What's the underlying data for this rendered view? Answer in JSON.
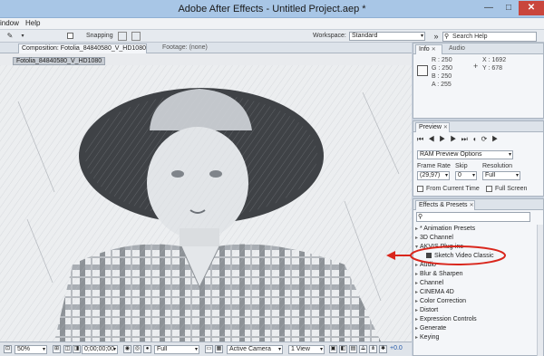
{
  "window": {
    "title": "Adobe After Effects - Untitled Project.aep *"
  },
  "menu": [
    "indow",
    "Help"
  ],
  "toolbar": {
    "snapping_label": "Snapping",
    "workspace_label": "Workspace:",
    "workspace_value": "Standard",
    "search_placeholder": "Search Help"
  },
  "composition_panel": {
    "tab_label": "Composition: Fotolia_84840580_V_HD1080",
    "footage_tab_label": "Footage: (none)",
    "layer_tag": "Fotolia_84840580_V_HD1080"
  },
  "viewer_status": {
    "magnification": "50%",
    "timecode": "0;00;00;00",
    "resolution": "Full",
    "camera": "Active Camera",
    "view": "1 View",
    "exposure": "+0.0"
  },
  "info_panel": {
    "tab_info": "Info",
    "tab_audio": "Audio",
    "r_label": "R :",
    "r_value": "250",
    "g_label": "G :",
    "g_value": "250",
    "b_label": "B :",
    "b_value": "250",
    "a_label": "A :",
    "a_value": "255",
    "x_label": "X :",
    "x_value": "1692",
    "y_label": "Y :",
    "y_value": "678"
  },
  "preview_panel": {
    "tab_label": "Preview",
    "ram_preview": "RAM Preview Options",
    "frame_rate_label": "Frame Rate",
    "frame_rate_value": "(29,97)",
    "skip_label": "Skip",
    "skip_value": "0",
    "resolution_label": "Resolution",
    "resolution_value": "Full",
    "from_current_time": "From Current Time",
    "full_screen": "Full Screen"
  },
  "effects_panel": {
    "tab_label": "Effects & Presets",
    "search_value": "",
    "items": [
      {
        "label": "* Animation Presets",
        "sub": false
      },
      {
        "label": "3D Channel",
        "sub": false
      },
      {
        "label": "AKVIS Plug-ins",
        "sub": false
      },
      {
        "label": "Sketch Video Classic",
        "sub": true
      },
      {
        "label": "Audio",
        "sub": false
      },
      {
        "label": "Blur & Sharpen",
        "sub": false
      },
      {
        "label": "Channel",
        "sub": false
      },
      {
        "label": "CINEMA 4D",
        "sub": false
      },
      {
        "label": "Color Correction",
        "sub": false
      },
      {
        "label": "Distort",
        "sub": false
      },
      {
        "label": "Expression Controls",
        "sub": false
      },
      {
        "label": "Generate",
        "sub": false
      },
      {
        "label": "Keying",
        "sub": false
      }
    ]
  },
  "colors": {
    "annotation_red": "#d9261c",
    "titlebar": "#a8c6e6",
    "timecode_blue": "#2659a8"
  }
}
